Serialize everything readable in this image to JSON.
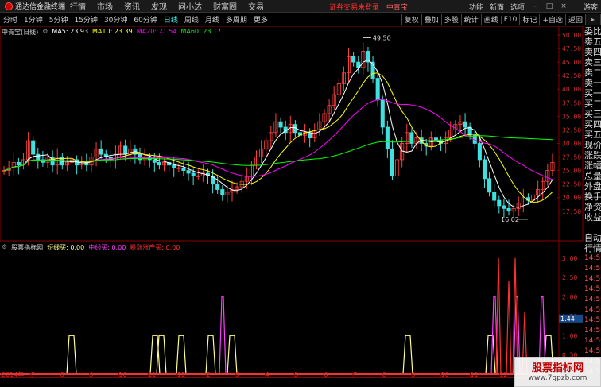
{
  "menubar": {
    "logo": "通达信金融终端",
    "items": [
      "行情",
      "市场",
      "资讯",
      "发现",
      "问小达",
      "财富圈",
      "交易"
    ],
    "status": "证券交易未登录",
    "stock": "中青宝",
    "right": [
      "功能",
      "新面",
      "选项"
    ],
    "user": "游客"
  },
  "periods": [
    "分时",
    "1分钟",
    "5分钟",
    "15分钟",
    "30分钟",
    "60分钟",
    "日线",
    "周线",
    "月线",
    "多周期",
    "更多"
  ],
  "active_period": "日线",
  "toolbar": [
    "复权",
    "叠加",
    "多股",
    "统计",
    "画线",
    "F10",
    "标记",
    "+自选",
    "返回"
  ],
  "ma": {
    "title": "中青宝(日线)",
    "ma5": "MA5: 23.93",
    "ma10": "MA10: 23.39",
    "ma20": "MA20: 21.54",
    "ma60": "MA60: 23.17",
    "c5": "#ffffff",
    "c10": "#ffff00",
    "c20": "#ff00ff",
    "c60": "#00ff00"
  },
  "indicator": {
    "title": "股票指标网",
    "a": "短线买: 0.00",
    "b": "中线买: 0.00",
    "c": "暴涨涨产买: 0.00",
    "ca": "#ffff88",
    "cb": "#ff3fff",
    "cc": "#ff3030"
  },
  "price_axis": [
    "50.00",
    "47.50",
    "45.00",
    "42.50",
    "40.00",
    "37.50",
    "35.00",
    "32.50",
    "30.00",
    "27.50",
    "25.00",
    "22.50",
    "20.00",
    "17.50"
  ],
  "ind_axis": [
    "3.00",
    "2.50",
    "2.00",
    "1.50",
    "1.00",
    "0.50"
  ],
  "hi_label": "49.50",
  "lo_label": "16.02",
  "ind_marker": "1.44",
  "xaxis": [
    "2014年",
    "7",
    "8",
    "9",
    "10",
    "11",
    "12",
    "2",
    "3",
    "4",
    "5",
    "6",
    "7",
    "8",
    "9",
    "10",
    "11",
    "12",
    "2"
  ],
  "rightpanel": [
    "委比",
    "卖五",
    "卖四",
    "卖三",
    "卖二",
    "卖一",
    "买一",
    "买二",
    "买三",
    "买四",
    "买五",
    "现价",
    "涨跌",
    "涨幅",
    "总量",
    "外盘",
    "换手",
    "净资",
    "收益",
    "",
    "自动",
    "行情",
    "14:50",
    "14:50",
    "14:50",
    "14:50",
    "14:50",
    "14:50",
    "14:50",
    "14:50",
    "14:50",
    "14:50",
    "14:50",
    "14:50"
  ],
  "watermark": {
    "line1": "股票指标网",
    "line2": "www.7gpzb.com"
  },
  "chart_data": {
    "type": "candlestick",
    "price_range": [
      16,
      50
    ],
    "close": [
      25,
      25.5,
      26.5,
      26,
      27,
      30.5,
      28,
      27,
      26.5,
      27.5,
      26,
      27.5,
      26,
      26.5,
      27,
      26,
      26.5,
      26,
      27.5,
      29,
      28,
      27.5,
      27,
      28,
      29.5,
      28,
      29,
      28,
      27,
      27.5,
      27,
      26.5,
      26,
      26.5,
      26,
      25.5,
      25.5,
      25,
      24.5,
      24,
      24,
      24.5,
      24,
      22.5,
      21.5,
      20.5,
      21,
      21.5,
      22,
      23,
      24,
      26,
      27.5,
      29,
      30.5,
      32,
      34,
      33,
      32,
      33.5,
      32,
      31.5,
      32,
      31,
      32.5,
      34,
      35.5,
      37,
      39,
      41,
      43,
      46,
      45,
      44,
      47,
      45,
      42,
      38,
      33,
      29,
      24,
      27,
      30,
      32,
      30,
      31,
      30,
      29.5,
      31,
      30.5,
      30,
      31,
      32.5,
      33.5,
      34,
      33,
      31.5,
      30,
      27,
      23.5,
      21,
      19.5,
      18.5,
      18,
      17.5,
      18,
      19,
      20,
      19.5,
      20.5,
      21.5,
      23,
      25,
      26.5
    ]
  }
}
